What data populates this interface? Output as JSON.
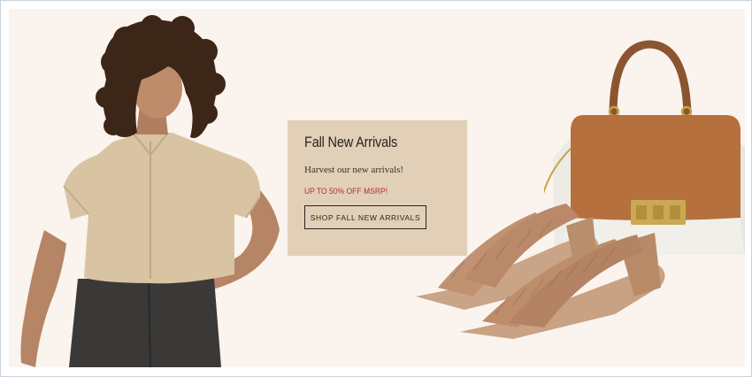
{
  "promo": {
    "title": "Fall New Arrivals",
    "subtitle": "Harvest our new arrivals!",
    "sale_text": "UP TO 50% OFF MSRP!",
    "cta_label": "SHOP FALL NEW ARRIVALS"
  },
  "images": {
    "model": "woman-in-linen-crop-top",
    "bag": "brown-and-cream-leather-handbag",
    "sandals": "woven-block-heel-sandals"
  },
  "colors": {
    "banner_background": "#faf3ee",
    "card_background": "#e1cfb7",
    "sale_red": "#b0303b",
    "text_dark": "#2a2420"
  }
}
